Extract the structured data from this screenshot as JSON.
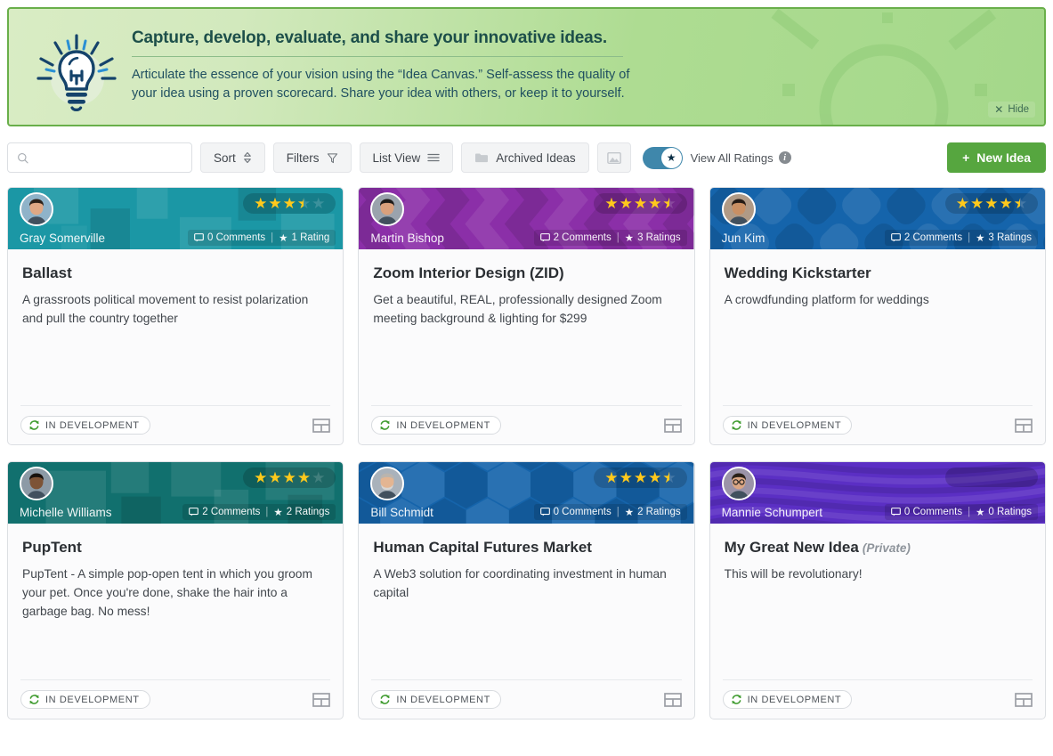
{
  "banner": {
    "title": "Capture, develop, evaluate, and share your innovative ideas.",
    "subtitle": "Articulate the essence of your vision using the “Idea Canvas.” Self-assess the quality of your idea using a proven scorecard. Share your idea with others, or keep it to yourself.",
    "hide_label": "Hide",
    "hide_icon": "close-icon",
    "bulb_icon": "lightbulb-icon",
    "border_color": "#69af4a",
    "bg_from": "#d9ecc4",
    "bg_to": "#a4d88a",
    "title_color": "#1d4f4a"
  },
  "toolbar": {
    "search_placeholder": "",
    "search_value": "",
    "search_icon": "search-icon",
    "sort_label": "Sort",
    "sort_icon": "sort-updown-icon",
    "filters_label": "Filters",
    "filters_icon": "funnel-icon",
    "list_view_label": "List View",
    "list_view_icon": "hamburger-lines-icon",
    "archived_label": "Archived Ideas",
    "archived_icon": "folder-icon",
    "image_view_icon": "image-icon",
    "toggle_on": true,
    "toggle_icon": "star-icon",
    "toggle_label": "View All Ratings",
    "info_icon": "info-icon",
    "info_glyph": "i",
    "new_idea_label": "New Idea",
    "new_idea_icon": "plus-icon",
    "new_idea_color": "#56a63f",
    "toggle_color": "#3f87ab"
  },
  "cards": [
    {
      "author": "Gray Somerville",
      "avatar": "avatar-gray-somerville",
      "comments": "0 Comments",
      "ratings": "1 Rating",
      "stars_full": 3,
      "stars_half": 1,
      "stars_empty": 1,
      "title": "Ballast",
      "private_label": "",
      "description": "A grassroots political movement to resist polarization and pull the country together",
      "status": "IN DEVELOPMENT",
      "status_icon": "sync-icon",
      "canvas_icon": "idea-canvas-icon",
      "header_color": "#1b97a5",
      "pattern": "squares"
    },
    {
      "author": "Martin Bishop",
      "avatar": "avatar-martin-bishop",
      "comments": "2 Comments",
      "ratings": "3 Ratings",
      "stars_full": 4,
      "stars_half": 1,
      "stars_empty": 0,
      "title": "Zoom Interior Design (ZID)",
      "private_label": "",
      "description": "Get a beautiful, REAL, professionally designed Zoom meeting background & lighting for $299",
      "status": "IN DEVELOPMENT",
      "status_icon": "sync-icon",
      "canvas_icon": "idea-canvas-icon",
      "header_color": "#8b2fa8",
      "pattern": "chevrons"
    },
    {
      "author": "Jun Kim",
      "avatar": "avatar-jun-kim",
      "comments": "2 Comments",
      "ratings": "3 Ratings",
      "stars_full": 4,
      "stars_half": 1,
      "stars_empty": 0,
      "title": "Wedding Kickstarter",
      "private_label": "",
      "description": "A crowdfunding platform for weddings",
      "status": "IN DEVELOPMENT",
      "status_icon": "sync-icon",
      "canvas_icon": "idea-canvas-icon",
      "header_color": "#1564ab",
      "pattern": "rounded-diamonds"
    },
    {
      "author": "Michelle Williams",
      "avatar": "avatar-michelle-williams",
      "comments": "2 Comments",
      "ratings": "2 Ratings",
      "stars_full": 4,
      "stars_half": 0,
      "stars_empty": 1,
      "title": "PupTent",
      "private_label": "",
      "description": "PupTent - A simple pop-open tent in which you groom your pet. Once you're done, shake the hair into a garbage bag. No mess!",
      "status": "IN DEVELOPMENT",
      "status_icon": "sync-icon",
      "canvas_icon": "idea-canvas-icon",
      "header_color": "#11706e",
      "pattern": "blocks"
    },
    {
      "author": "Bill Schmidt",
      "avatar": "avatar-bill-schmidt",
      "comments": "0 Comments",
      "ratings": "2 Ratings",
      "stars_full": 4,
      "stars_half": 1,
      "stars_empty": 0,
      "title": "Human Capital Futures Market",
      "private_label": "",
      "description": "A Web3 solution for coordinating investment in human capital",
      "status": "IN DEVELOPMENT",
      "status_icon": "sync-icon",
      "canvas_icon": "idea-canvas-icon",
      "header_color": "#1564ab",
      "pattern": "hexagons"
    },
    {
      "author": "Mannie Schumpert",
      "avatar": "avatar-mannie-schumpert",
      "comments": "0 Comments",
      "ratings": "0 Ratings",
      "stars_full": 0,
      "stars_half": 0,
      "stars_empty": 0,
      "title": "My Great New Idea",
      "private_label": "(Private)",
      "description": "This will be revolutionary!",
      "status": "IN DEVELOPMENT",
      "status_icon": "sync-icon",
      "canvas_icon": "idea-canvas-icon",
      "header_color": "#5b2fc4",
      "pattern": "waves"
    }
  ]
}
